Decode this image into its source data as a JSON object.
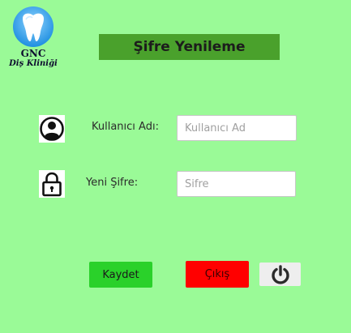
{
  "logo": {
    "brand": "GNC",
    "subtitle": "Diş Kliniği",
    "icon": "tooth-icon"
  },
  "page_title": "Şifre Yenileme",
  "form": {
    "username": {
      "label": "Kullanıcı Adı:",
      "placeholder": "Kullanıcı Ad",
      "value": "",
      "icon": "user-icon"
    },
    "new_password": {
      "label": "Yeni Şifre:",
      "placeholder": "Sifre",
      "value": "",
      "icon": "lock-icon"
    }
  },
  "buttons": {
    "save_label": "Kaydet",
    "exit_label": "Çıkış",
    "power_icon": "power-icon"
  },
  "colors": {
    "background": "#9afa97",
    "title_bar": "#4aa12c",
    "save_button": "#2ad12a",
    "exit_button": "#ff0000",
    "logo_circle": "#2fa3ee"
  }
}
